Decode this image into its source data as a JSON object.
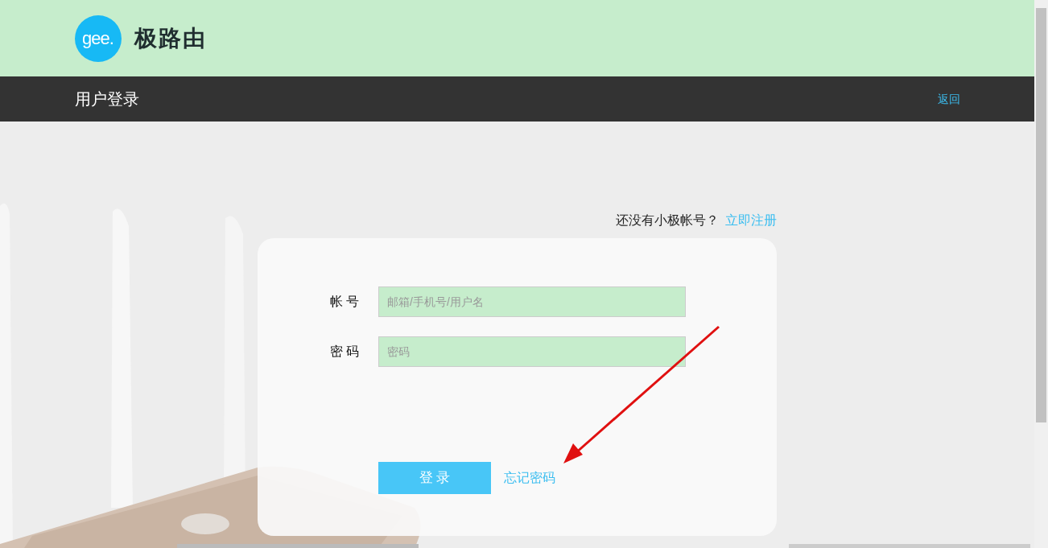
{
  "header": {
    "logo_text": "gee.",
    "brand": "极路由"
  },
  "nav_bar": {
    "title": "用户登录",
    "back_link": "返回"
  },
  "register_prompt": {
    "text": "还没有小极帐号？",
    "link": "立即注册"
  },
  "form": {
    "fields": [
      {
        "label": "帐 号",
        "placeholder": "邮箱/手机号/用户名"
      },
      {
        "label": "密 码",
        "placeholder": "密码"
      }
    ],
    "submit": "登 录",
    "forgot_link": "忘记密码"
  }
}
